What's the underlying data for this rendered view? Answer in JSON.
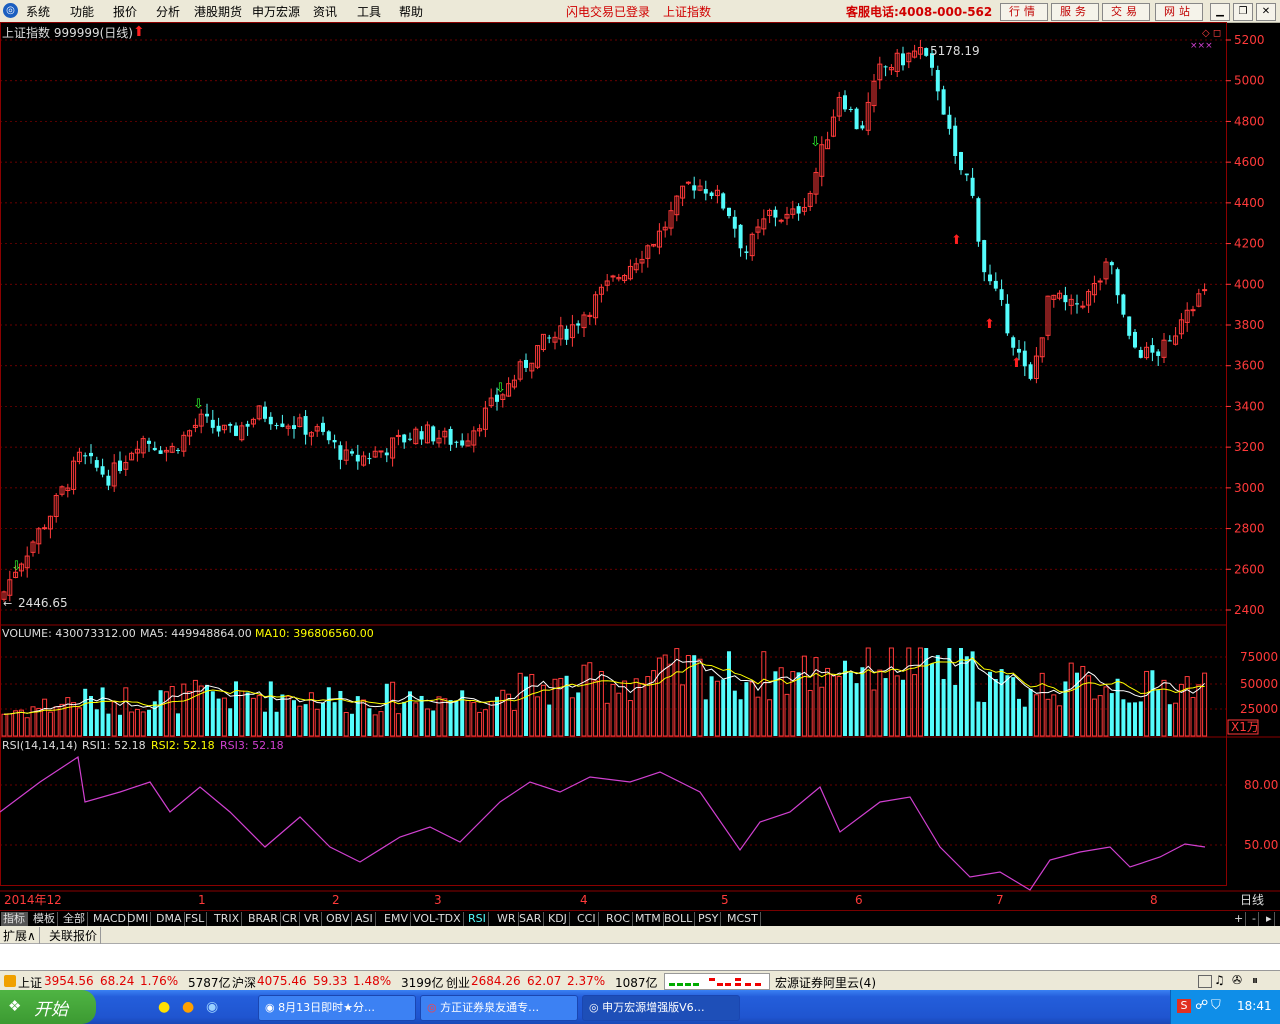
{
  "menu": {
    "items": [
      "系统",
      "功能",
      "报价",
      "分析",
      "港股期货",
      "申万宏源",
      "资讯",
      "工具",
      "帮助"
    ],
    "notice1": "闪电交易已登录",
    "notice2": "上证指数",
    "hotline": "客服电话:4008-000-562",
    "nav_buttons": [
      "行情",
      "服务",
      "交易",
      "网站"
    ]
  },
  "chart_header": {
    "title": "上证指数 999999(日线)"
  },
  "price_axis": {
    "ticks": [
      "5200",
      "5000",
      "4800",
      "4600",
      "4400",
      "4200",
      "4000",
      "3800",
      "3600",
      "3400",
      "3200",
      "3000",
      "2800",
      "2600",
      "2400"
    ]
  },
  "annotations": {
    "high": "5178.19",
    "low": "2446.65"
  },
  "volume": {
    "label": "VOLUME: 430073312.00",
    "ma5": "MA5: 449948864.00",
    "ma10": "MA10: 396806560.00",
    "ticks": [
      "75000",
      "50000",
      "25000"
    ],
    "unit": "X1万"
  },
  "rsi": {
    "label": "RSI(14,14,14)",
    "rsi1": "RSI1: 52.18",
    "rsi2": "RSI2: 52.18",
    "rsi3": "RSI3: 52.18",
    "ticks": [
      "80.00",
      "50.00"
    ]
  },
  "time_axis": {
    "labels": [
      "2014年12",
      "1",
      "2",
      "3",
      "4",
      "5",
      "6",
      "7",
      "8"
    ],
    "period": "日线"
  },
  "indicator_tabs": [
    "指标",
    "模板",
    "全部",
    "MACD",
    "DMI",
    "DMA",
    "FSL",
    "TRIX",
    "BRAR",
    "CR",
    "VR",
    "OBV",
    "ASI",
    "EMV",
    "VOL-TDX",
    "RSI",
    "WR",
    "SAR",
    "KDJ",
    "CCI",
    "ROC",
    "MTM",
    "BOLL",
    "PSY",
    "MCST"
  ],
  "ext_tabs": [
    "扩展∧",
    "关联报价"
  ],
  "status": {
    "sh_name": "上证",
    "sh_val": "3954.56",
    "sh_chg": "68.24",
    "sh_pct": "1.76%",
    "sh_amt": "5787亿",
    "hs_name": "沪深",
    "hs_val": "4075.46",
    "hs_chg": "59.33",
    "hs_pct": "1.48%",
    "hs_amt": "3199亿",
    "cy_name": "创业",
    "cy_val": "2684.26",
    "cy_chg": "62.07",
    "cy_pct": "2.37%",
    "cy_amt": "1087亿",
    "broker": "宏源证券阿里云(4)"
  },
  "taskbar": {
    "start": "开始",
    "tasks": [
      "8月13日即时★分…",
      "方正证券泉友通专…",
      "申万宏源增强版V6…"
    ],
    "clock": "18:41"
  },
  "colors": {
    "up": "#ff3a3a",
    "down": "#54fcfc",
    "ma5": "#ffffff",
    "ma10": "#ffff00",
    "rsi": "#d040d0",
    "grid": "#8b0000"
  }
}
